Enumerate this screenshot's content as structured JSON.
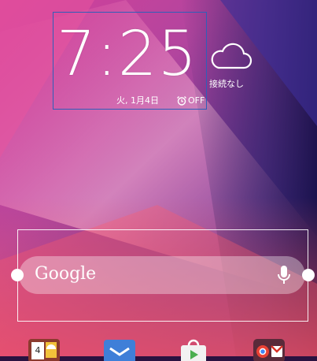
{
  "clock": {
    "time": "7:25",
    "date": "火, 1月4日",
    "alarm": "OFF"
  },
  "weather": {
    "status": "接続なし"
  },
  "search": {
    "label": "Google"
  },
  "dock": {
    "calendar_day": "4",
    "apps": [
      "calendar-icon",
      "email-icon",
      "play-store-icon",
      "chrome-gmail-folder-icon"
    ]
  },
  "colors": {
    "selection_frame": "#2f5fb8",
    "text": "#ffffff"
  }
}
